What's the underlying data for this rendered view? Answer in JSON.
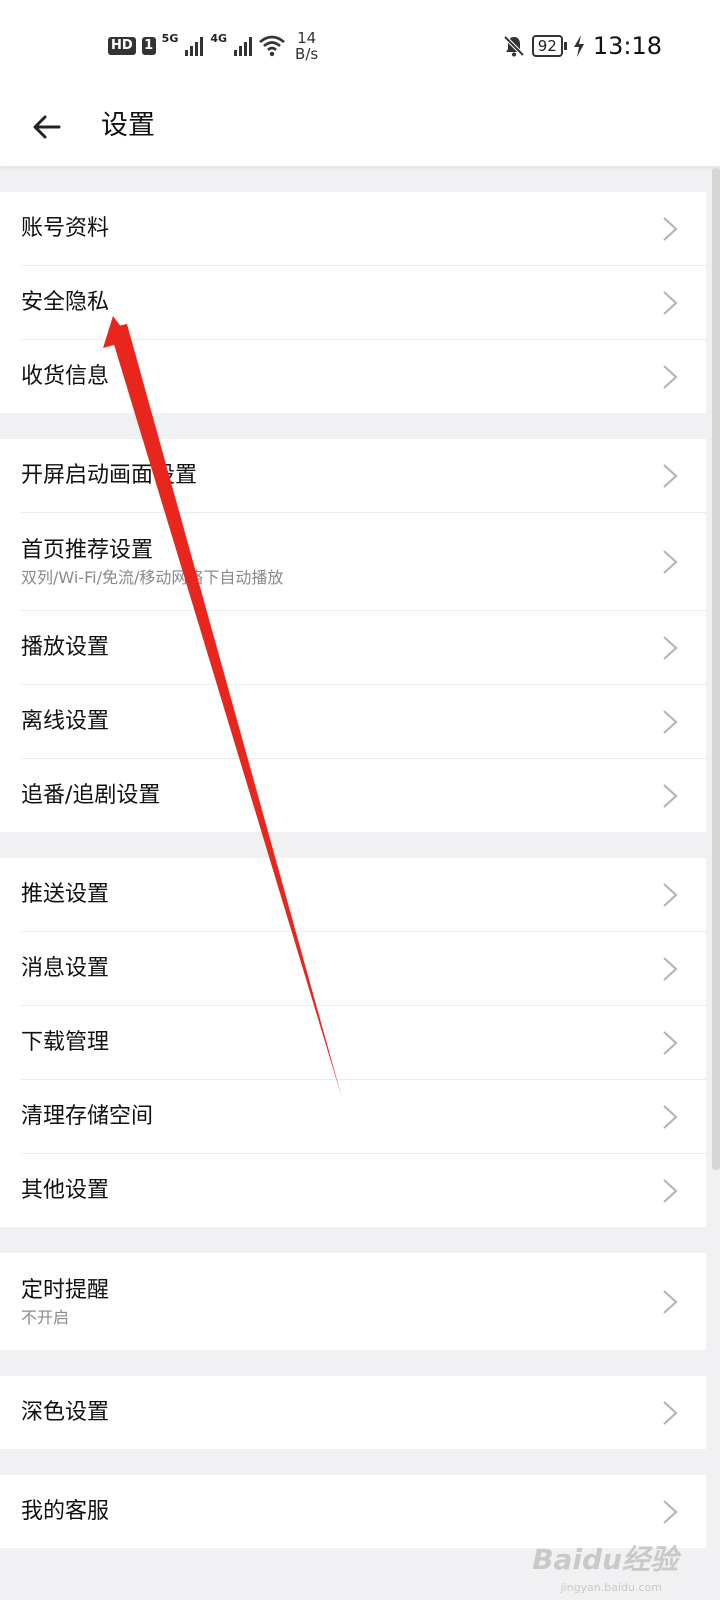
{
  "status_bar": {
    "hd": "HD",
    "sim": "1",
    "net1": "5G",
    "net2": "4G",
    "speed_value": "14",
    "speed_unit": "B/s",
    "battery": "92",
    "time": "13:18"
  },
  "header": {
    "title": "设置"
  },
  "groups": [
    {
      "items": [
        {
          "label": "账号资料",
          "sub": ""
        },
        {
          "label": "安全隐私",
          "sub": ""
        },
        {
          "label": "收货信息",
          "sub": ""
        }
      ]
    },
    {
      "items": [
        {
          "label": "开屏启动画面设置",
          "sub": ""
        },
        {
          "label": "首页推荐设置",
          "sub": "双列/Wi-Fi/免流/移动网络下自动播放"
        },
        {
          "label": "播放设置",
          "sub": ""
        },
        {
          "label": "离线设置",
          "sub": ""
        },
        {
          "label": "追番/追剧设置",
          "sub": ""
        }
      ]
    },
    {
      "items": [
        {
          "label": "推送设置",
          "sub": ""
        },
        {
          "label": "消息设置",
          "sub": ""
        },
        {
          "label": "下载管理",
          "sub": ""
        },
        {
          "label": "清理存储空间",
          "sub": ""
        },
        {
          "label": "其他设置",
          "sub": ""
        }
      ]
    },
    {
      "items": [
        {
          "label": "定时提醒",
          "sub": "不开启"
        }
      ]
    },
    {
      "items": [
        {
          "label": "深色设置",
          "sub": ""
        }
      ]
    },
    {
      "items": [
        {
          "label": "我的客服",
          "sub": ""
        }
      ]
    }
  ],
  "watermark": {
    "brand": "Baidu经验",
    "url": "jingyan.baidu.com"
  },
  "colors": {
    "annotation_arrow": "#e8261e",
    "chevron": "#b5b5b5",
    "background": "#f1f1f3"
  },
  "icons": {
    "back": "arrow-left-icon",
    "row": "chevron-right-icon"
  }
}
